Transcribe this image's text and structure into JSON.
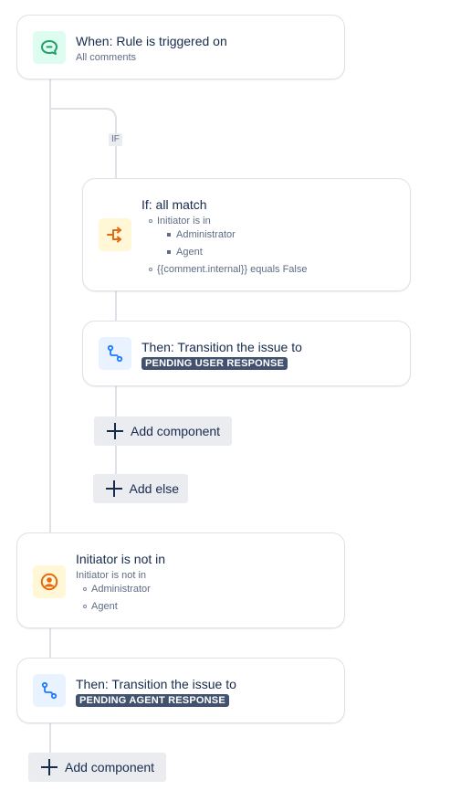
{
  "trigger": {
    "title": "When: Rule is triggered on",
    "subtitle": "All comments",
    "icon": "comment-icon",
    "tile_color": "#dffcf0",
    "icon_color": "#36b37e"
  },
  "branch_badge": "IF",
  "if_block": {
    "title": "If: all match",
    "icon": "branch-icon",
    "tile_color": "#fff7d6",
    "icon_color": "#ff8b00",
    "conditions": [
      {
        "label": "Initiator is in",
        "values": [
          "Administrator",
          "Agent"
        ]
      },
      {
        "label": "{{comment.internal}} equals False"
      }
    ]
  },
  "then_user": {
    "title": "Then: Transition the issue to",
    "status": "PENDING USER RESPONSE",
    "icon": "transition-icon",
    "tile_color": "#e9f2ff",
    "icon_color": "#0c66e4"
  },
  "buttons": {
    "add_component_inner": "Add component",
    "add_else": "Add else",
    "add_component_outer": "Add component"
  },
  "initiator_block": {
    "title": "Initiator is not in",
    "subtitle": "Initiator is not in",
    "values": [
      "Administrator",
      "Agent"
    ],
    "icon": "user-icon",
    "tile_color": "#fff7d6",
    "icon_color": "#ff8b00"
  },
  "then_agent": {
    "title": "Then: Transition the issue to",
    "status": "PENDING AGENT RESPONSE",
    "icon": "transition-icon",
    "tile_color": "#e9f2ff",
    "icon_color": "#0c66e4"
  }
}
